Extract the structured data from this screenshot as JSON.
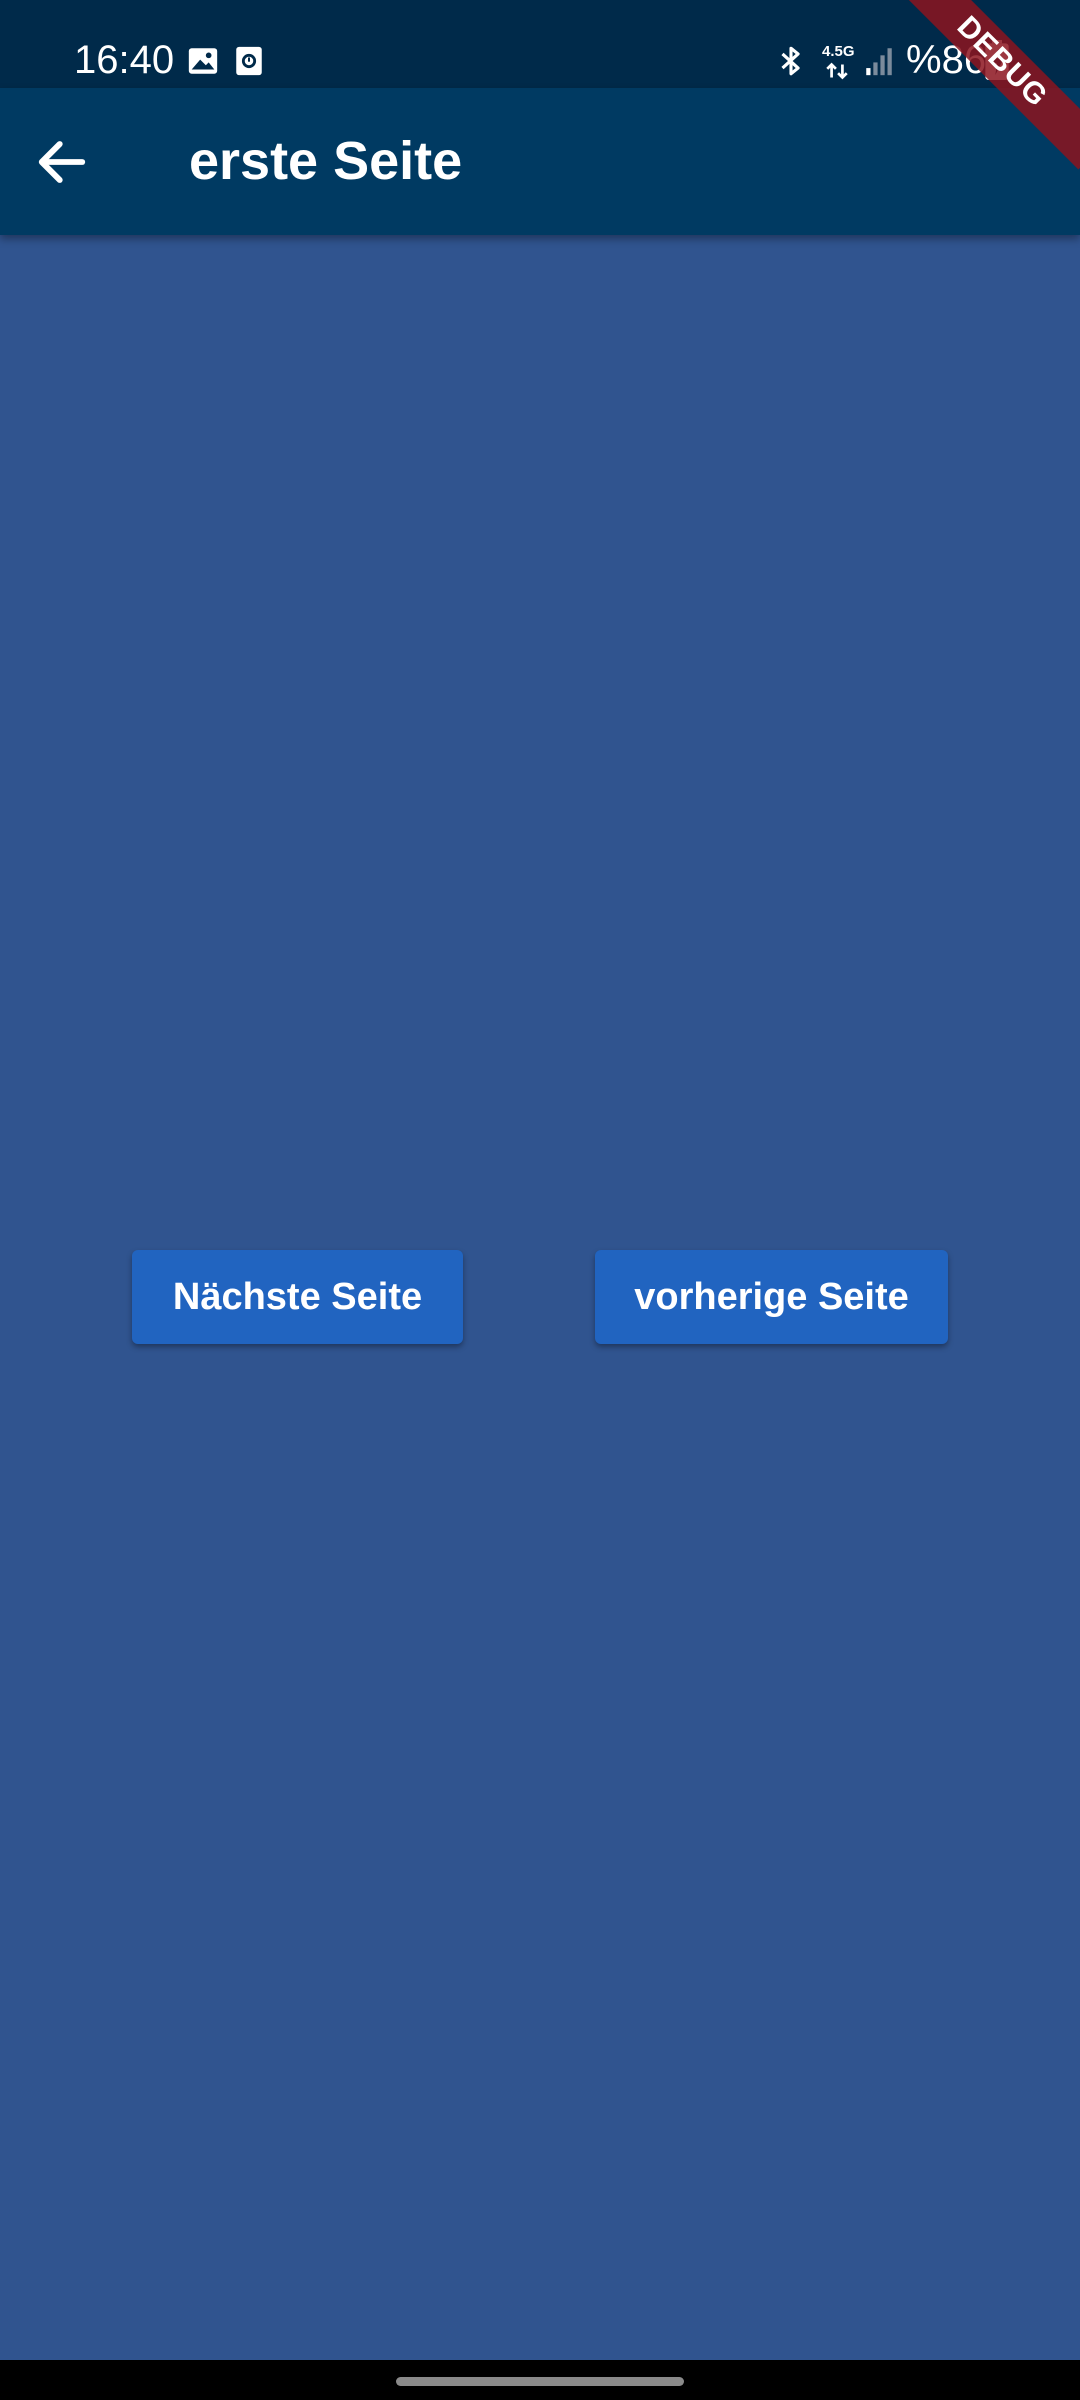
{
  "status_bar": {
    "time": "16:40",
    "network_label": "4.5G",
    "battery_text": "%86",
    "icons": [
      "gallery-icon",
      "screen-record-icon",
      "bluetooth-icon",
      "mobile-data-icon",
      "signal-icon",
      "battery-icon"
    ]
  },
  "app_bar": {
    "back_icon": "back-arrow-icon",
    "title": "erste Seite"
  },
  "debug_banner": {
    "label": "DEBUG"
  },
  "buttons": {
    "next_label": "Nächste Seite",
    "prev_label": "vorherige Seite"
  },
  "colors": {
    "status_bar": "#002a4a",
    "app_bar": "#003a62",
    "background": "#30548f",
    "button": "#2164c0",
    "debug_banner": "#8c141e"
  }
}
